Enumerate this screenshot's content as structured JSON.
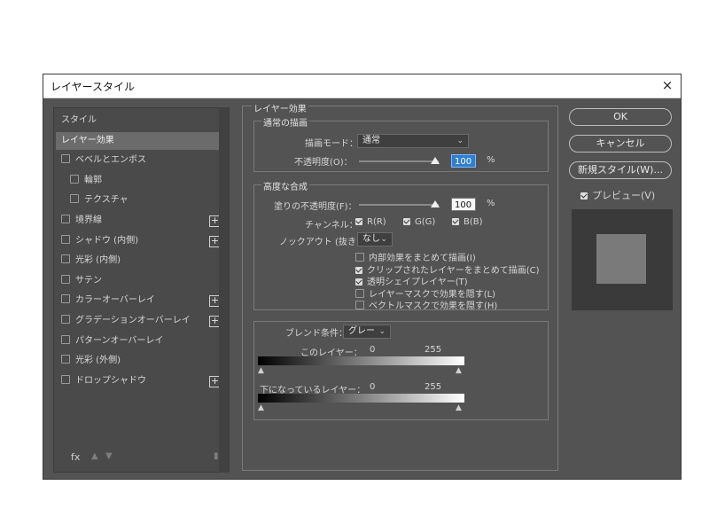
{
  "window": {
    "title": "レイヤースタイル",
    "close": "×"
  },
  "styles_list": {
    "items": [
      {
        "label": "スタイル",
        "checkbox": false,
        "plus": false,
        "selected": false,
        "sub": false
      },
      {
        "label": "レイヤー効果",
        "checkbox": false,
        "plus": false,
        "selected": true,
        "sub": false
      },
      {
        "label": "ベベルとエンボス",
        "checkbox": true,
        "plus": false,
        "selected": false,
        "sub": false
      },
      {
        "label": "輪郭",
        "checkbox": true,
        "plus": false,
        "selected": false,
        "sub": true
      },
      {
        "label": "テクスチャ",
        "checkbox": true,
        "plus": false,
        "selected": false,
        "sub": true
      },
      {
        "label": "境界線",
        "checkbox": true,
        "plus": true,
        "selected": false,
        "sub": false
      },
      {
        "label": "シャドウ (内側)",
        "checkbox": true,
        "plus": true,
        "selected": false,
        "sub": false
      },
      {
        "label": "光彩 (内側)",
        "checkbox": true,
        "plus": false,
        "selected": false,
        "sub": false
      },
      {
        "label": "サテン",
        "checkbox": true,
        "plus": false,
        "selected": false,
        "sub": false
      },
      {
        "label": "カラーオーバーレイ",
        "checkbox": true,
        "plus": true,
        "selected": false,
        "sub": false
      },
      {
        "label": "グラデーションオーバーレイ",
        "checkbox": true,
        "plus": true,
        "selected": false,
        "sub": false
      },
      {
        "label": "パターンオーバーレイ",
        "checkbox": true,
        "plus": false,
        "selected": false,
        "sub": false
      },
      {
        "label": "光彩 (外側)",
        "checkbox": true,
        "plus": false,
        "selected": false,
        "sub": false
      },
      {
        "label": "ドロップシャドウ",
        "checkbox": true,
        "plus": true,
        "selected": false,
        "sub": false
      }
    ],
    "footer": {
      "fx": "fx"
    }
  },
  "effects": {
    "section_title": "レイヤー効果",
    "general_blending": {
      "legend": "通常の描画",
      "blend_mode_label": "描画モード：",
      "blend_mode_value": "通常",
      "opacity_label": "不透明度(O)：",
      "opacity_value": "100",
      "opacity_percent": 0.96,
      "unit": "%"
    },
    "advanced_blending": {
      "legend": "高度な合成",
      "fill_opacity_label": "塗りの不透明度(F)：",
      "fill_opacity_value": "100",
      "fill_opacity_percent": 0.96,
      "unit": "%",
      "channels_label": "チャンネル：",
      "channels": [
        "R(R)",
        "G(G)",
        "B(B)"
      ],
      "knockout_label": "ノックアウト (抜き)：",
      "knockout_value": "なし",
      "options": [
        {
          "label": "内部効果をまとめて描画(I)",
          "checked": false
        },
        {
          "label": "クリップされたレイヤーをまとめて描画(C)",
          "checked": true
        },
        {
          "label": "透明シェイプレイヤー(T)",
          "checked": true
        },
        {
          "label": "レイヤーマスクで効果を隠す(L)",
          "checked": false
        },
        {
          "label": "ベクトルマスクで効果を隠す(H)",
          "checked": false
        }
      ]
    },
    "blend_if": {
      "label": "ブレンド条件：",
      "value": "グレー",
      "this_layer_label": "このレイヤー：",
      "this_layer_min": "0",
      "this_layer_max": "255",
      "underlying_label": "下になっているレイヤー：",
      "underlying_min": "0",
      "underlying_max": "255"
    }
  },
  "actions": {
    "ok": "OK",
    "cancel": "キャンセル",
    "new_style": "新規スタイル(W)...",
    "preview_label": "プレビュー(V)",
    "preview_checked": true
  }
}
